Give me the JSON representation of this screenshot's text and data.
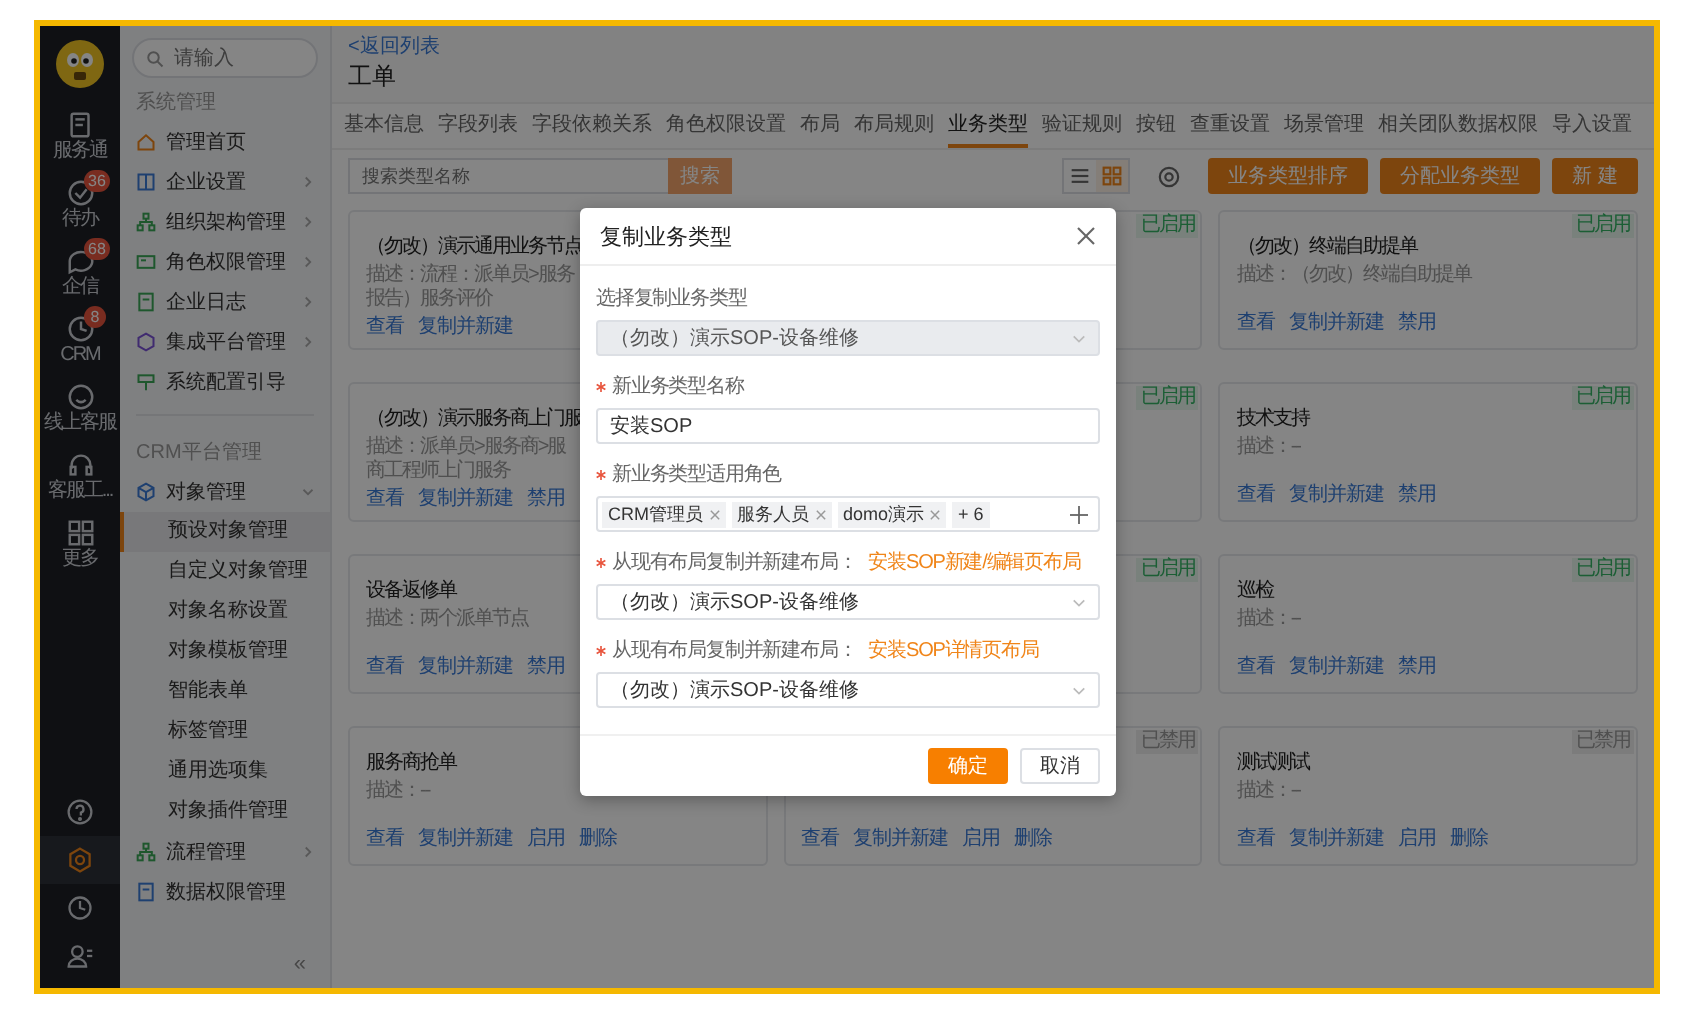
{
  "rail": {
    "items": [
      {
        "label": "服务通"
      },
      {
        "label": "待办",
        "badge": "36"
      },
      {
        "label": "企信",
        "badge": "68"
      },
      {
        "label": "CRM",
        "badge": "8"
      },
      {
        "label": "线上客服"
      },
      {
        "label": "客服工..."
      },
      {
        "label": "更多"
      }
    ],
    "bottom_icons": [
      {
        "selected": false
      },
      {
        "selected": true
      },
      {
        "selected": false
      },
      {
        "selected": false
      }
    ]
  },
  "sidebar": {
    "search": {
      "placeholder": "请输入"
    },
    "sections": [
      {
        "title": "系统管理",
        "items": [
          {
            "label": "管理首页",
            "expandable": false,
            "expanded": false
          },
          {
            "label": "企业设置",
            "expandable": true,
            "expanded": false
          },
          {
            "label": "组织架构管理",
            "expandable": true,
            "expanded": false
          },
          {
            "label": "角色权限管理",
            "expandable": true,
            "expanded": false
          },
          {
            "label": "企业日志",
            "expandable": true,
            "expanded": false
          },
          {
            "label": "集成平台管理",
            "expandable": true,
            "expanded": false
          },
          {
            "label": "系统配置引导",
            "expandable": false,
            "expanded": false
          }
        ]
      },
      {
        "title": "CRM平台管理",
        "items": [
          {
            "label": "对象管理",
            "expandable": true,
            "expanded": true,
            "children": [
              {
                "label": "预设对象管理",
                "selected": true
              },
              {
                "label": "自定义对象管理",
                "selected": false
              },
              {
                "label": "对象名称设置",
                "selected": false
              },
              {
                "label": "对象模板管理",
                "selected": false
              },
              {
                "label": "智能表单",
                "selected": false
              },
              {
                "label": "标签管理",
                "selected": false
              },
              {
                "label": "通用选项集",
                "selected": false
              },
              {
                "label": "对象插件管理",
                "selected": false
              }
            ]
          },
          {
            "label": "流程管理",
            "expandable": true,
            "expanded": false
          },
          {
            "label": "数据权限管理",
            "expandable": false,
            "expanded": false
          }
        ]
      }
    ],
    "collapse_label": "«"
  },
  "main": {
    "back_link": "<返回列表",
    "title": "工单",
    "tabs": [
      {
        "label": "基本信息",
        "selected": false
      },
      {
        "label": "字段列表",
        "selected": false
      },
      {
        "label": "字段依赖关系",
        "selected": false
      },
      {
        "label": "角色权限设置",
        "selected": false
      },
      {
        "label": "布局",
        "selected": false
      },
      {
        "label": "布局规则",
        "selected": false
      },
      {
        "label": "业务类型",
        "selected": true
      },
      {
        "label": "验证规则",
        "selected": false
      },
      {
        "label": "按钮",
        "selected": false
      },
      {
        "label": "查重设置",
        "selected": false
      },
      {
        "label": "场景管理",
        "selected": false
      },
      {
        "label": "相关团队数据权限",
        "selected": false
      },
      {
        "label": "导入设置",
        "selected": false
      }
    ],
    "search": {
      "placeholder": "搜索类型名称",
      "button": "搜索"
    },
    "view_toggle": [
      {
        "selected": false
      },
      {
        "selected": true
      }
    ],
    "buttons": [
      "业务类型排序",
      "分配业务类型",
      "新 建"
    ],
    "cards": [
      {
        "title": "（勿改）演示通用业务节点",
        "description": [
          "描述：流程：派单员>服务",
          "报告）服务评价"
        ],
        "actions": [
          "查看",
          "复制并新建"
        ]
      },
      {
        "status": {
          "text": "已启用",
          "enabled": true
        }
      },
      {
        "title": "（勿改）终端自助提单",
        "description": [
          "描述：（勿改）终端自助提单"
        ],
        "actions": [
          "查看",
          "复制并新建",
          "禁用"
        ],
        "status": {
          "text": "已启用",
          "enabled": true
        }
      },
      {
        "title": "（勿改）演示服务商上门服",
        "description": [
          "描述：派单员>服务商>服",
          "商工程师上门服务"
        ],
        "actions": [
          "查看",
          "复制并新建",
          "禁用"
        ]
      },
      {
        "status": {
          "text": "已启用",
          "enabled": true
        }
      },
      {
        "title": "技术支持",
        "description": [
          "描述：--"
        ],
        "actions": [
          "查看",
          "复制并新建",
          "禁用"
        ],
        "status": {
          "text": "已启用",
          "enabled": true
        }
      },
      {
        "title": "设备返修单",
        "description": [
          "描述：两个派单节点"
        ],
        "actions": [
          "查看",
          "复制并新建",
          "禁用"
        ]
      },
      {
        "status": {
          "text": "已启用",
          "enabled": true
        }
      },
      {
        "title": "巡检",
        "description": [
          "描述：--"
        ],
        "actions": [
          "查看",
          "复制并新建",
          "禁用"
        ],
        "status": {
          "text": "已启用",
          "enabled": true
        }
      },
      {
        "title": "服务商抢单",
        "description": [
          "描述：--"
        ],
        "actions": [
          "查看",
          "复制并新建",
          "启用",
          "删除"
        ]
      },
      {
        "actions": [
          "查看",
          "复制并新建",
          "启用",
          "删除"
        ],
        "status": {
          "text": "已禁用",
          "enabled": false
        }
      },
      {
        "title": "测试测试",
        "description": [
          "描述：--"
        ],
        "actions": [
          "查看",
          "复制并新建",
          "启用",
          "删除"
        ],
        "status": {
          "text": "已禁用",
          "enabled": false
        }
      }
    ]
  },
  "modal": {
    "title": "复制业务类型",
    "fields": [
      {
        "kind": "select",
        "label": "选择复制业务类型",
        "required": false,
        "value": "（勿改）演示SOP-设备维修",
        "disabled": true
      },
      {
        "kind": "input",
        "label": "新业务类型名称",
        "required": true,
        "value": "安装SOP",
        "disabled": false
      },
      {
        "kind": "tags",
        "label": "新业务类型适用角色",
        "required": true,
        "tags": [
          "CRM管理员",
          "服务人员",
          "domo演示"
        ],
        "more": "+ 6",
        "disabled": false
      },
      {
        "kind": "select",
        "label": "从现有布局复制并新建布局：",
        "required": true,
        "note": "安装SOP新建/编辑页布局",
        "value": "（勿改）演示SOP-设备维修",
        "disabled": false
      },
      {
        "kind": "select",
        "label": "从现有布局复制并新建布局：",
        "required": true,
        "note": "安装SOP详情页布局",
        "value": "（勿改）演示SOP-设备维修",
        "disabled": false
      }
    ],
    "buttons": [
      {
        "label": "确定",
        "primary": true
      },
      {
        "label": "取消",
        "primary": false
      }
    ]
  }
}
